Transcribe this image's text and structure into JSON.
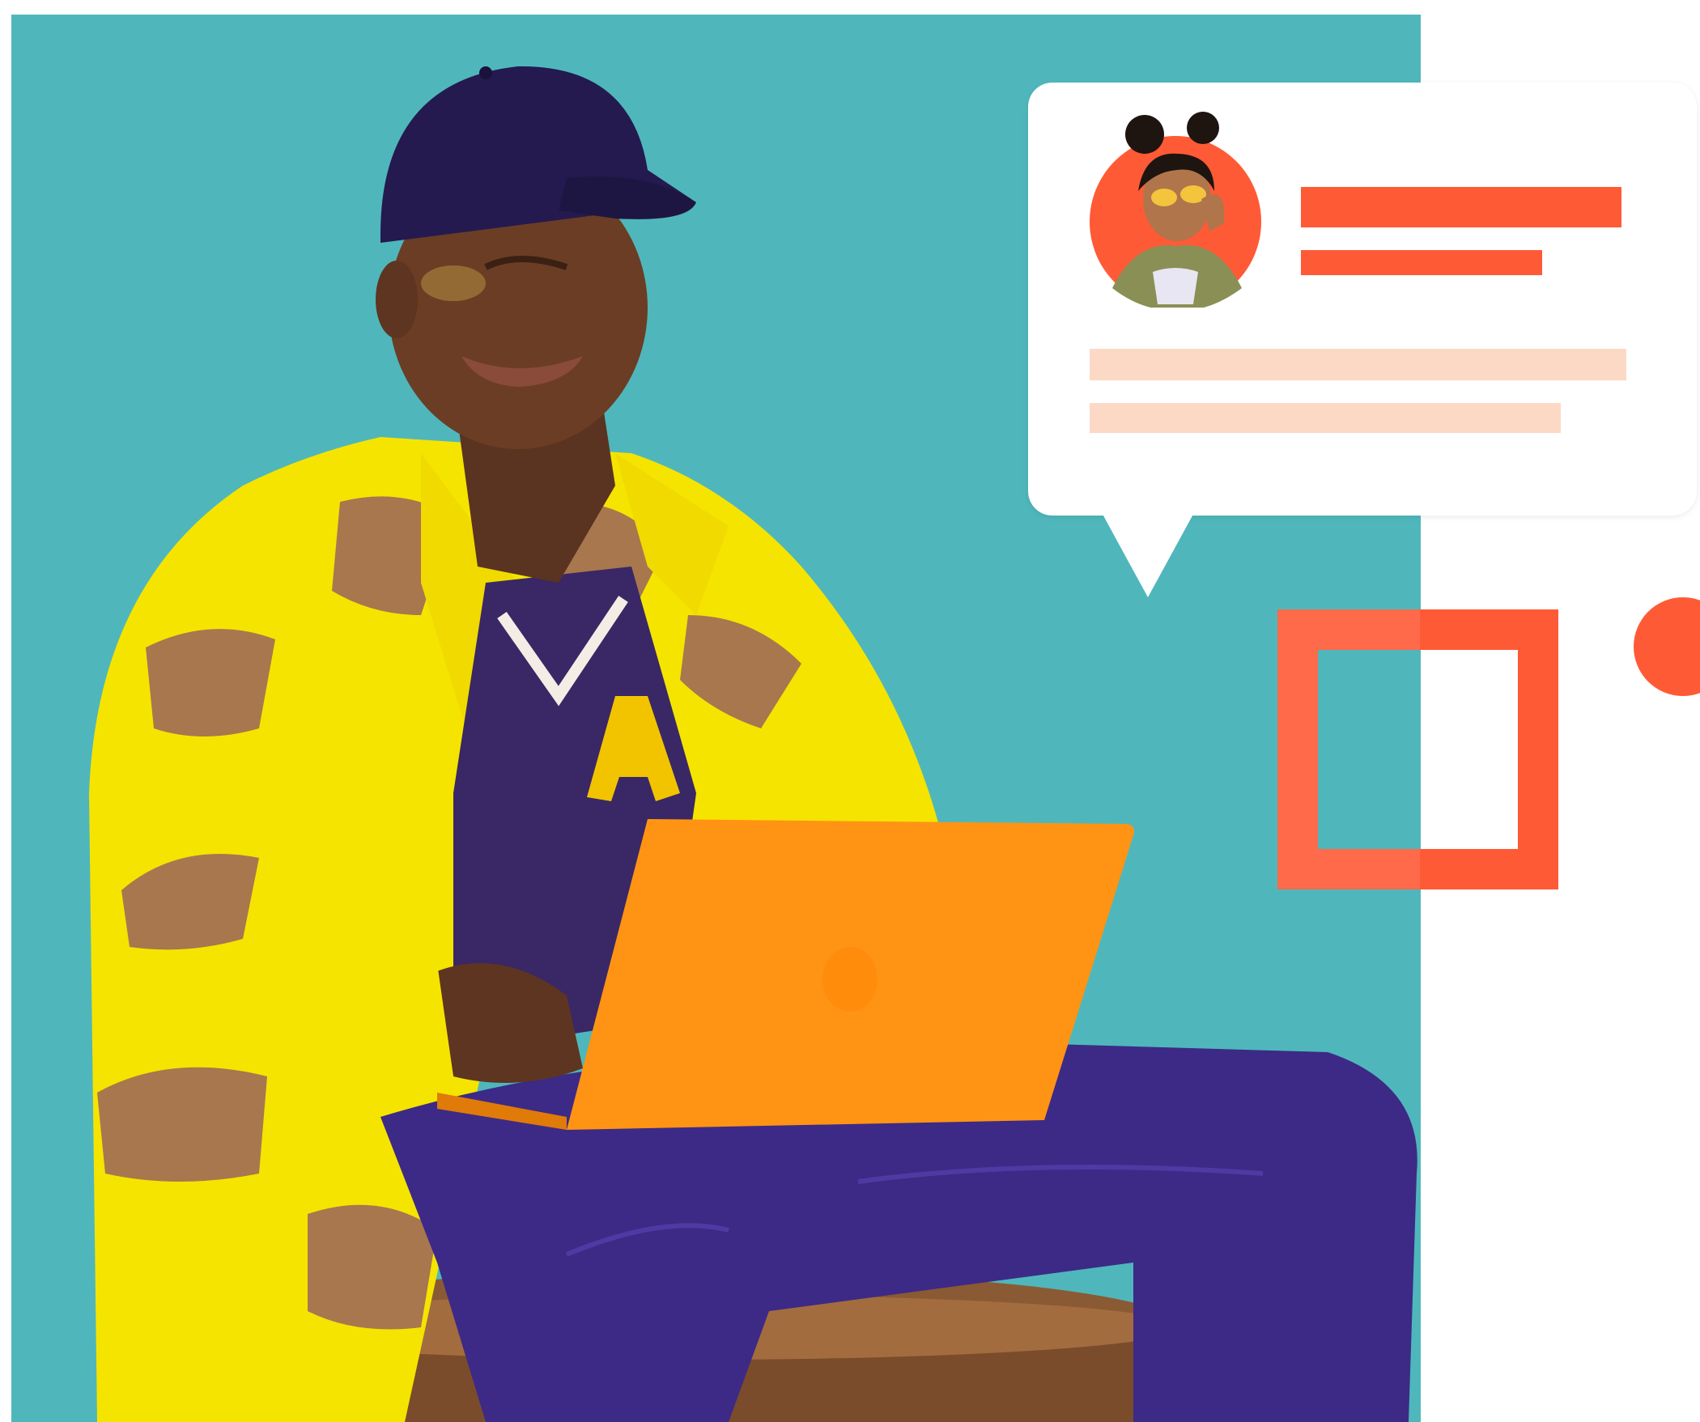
{
  "scene": {
    "background_color": "#4fb7bb",
    "accent_color": "#ff5a36",
    "placeholder_color": "#fcd9c5",
    "jacket_colors": [
      "#f5e400",
      "#a8774e"
    ],
    "laptop_color": "#ff9414",
    "jeans_color": "#3c2a86",
    "cap_color": "#241a4f"
  },
  "chat_card": {
    "avatar_ring_color": "#ff5a36",
    "headline_bars": 2,
    "body_bars": 2
  },
  "decorations": {
    "square_outline_color": "#ff5a36",
    "dot_color": "#ff5a36"
  }
}
